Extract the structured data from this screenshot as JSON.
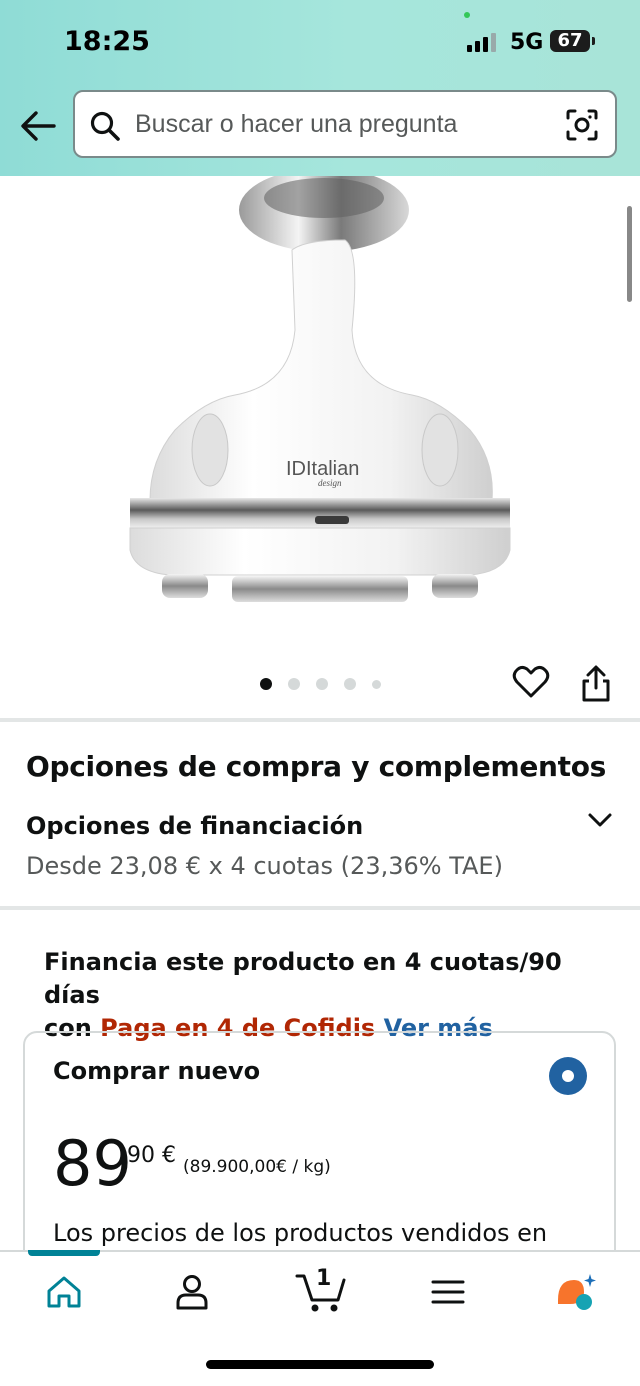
{
  "status_bar": {
    "time": "18:25",
    "network": "5G",
    "battery": "67"
  },
  "search": {
    "placeholder": "Buscar o hacer una pregunta"
  },
  "product": {
    "brand_logo_text": "IDItalian design",
    "image_dots_count": 5,
    "active_dot": 0
  },
  "purchase": {
    "section_title": "Opciones de compra y complementos",
    "financing_title": "Opciones de financiación",
    "financing_subtitle": "Desde 23,08 € x 4 cuotas (23,36% TAE)"
  },
  "promo": {
    "text_line1": "Financia este producto en 4 cuotas/90 días",
    "text_con": "con",
    "provider": "Paga en 4 de Cofidis",
    "link": "Ver más"
  },
  "buy_box": {
    "title": "Comprar nuevo",
    "price_whole": "89",
    "price_fraction": "90 €",
    "price_per_unit": "(89.900,00€ / kg)",
    "notice": "Los precios de los productos vendidos en"
  },
  "bottom_nav": {
    "cart_count": "1"
  },
  "colors": {
    "accent_teal": "#008296",
    "price_red": "#b12704",
    "link_blue": "#2162a1",
    "header_gradient": "#8fdcd6"
  }
}
